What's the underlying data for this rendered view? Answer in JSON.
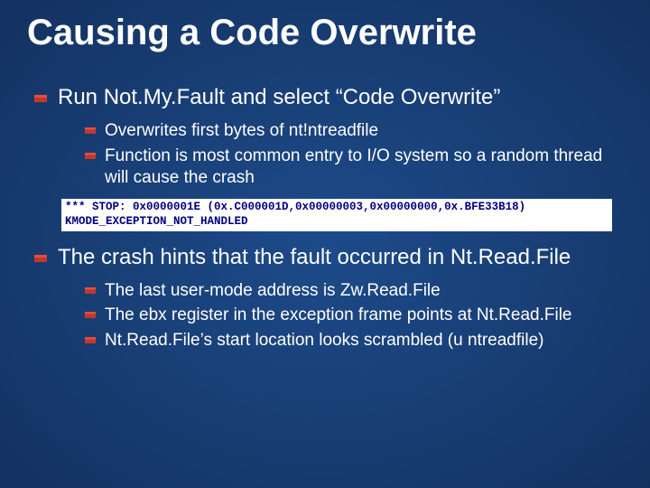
{
  "title": "Causing a Code Overwrite",
  "bullets": [
    {
      "text": "Run Not.My.Fault and select “Code Overwrite”",
      "children": [
        {
          "text": "Overwrites first bytes of nt!ntreadfile"
        },
        {
          "text": "Function is most common entry to I/O system so a random thread will cause the crash"
        }
      ]
    }
  ],
  "code": {
    "line1": "*** STOP: 0x0000001E (0x.C000001D,0x00000003,0x00000000,0x.BFE33B18)",
    "line2": "KMODE_EXCEPTION_NOT_HANDLED"
  },
  "bullets2": [
    {
      "text": "The crash hints that the fault occurred in Nt.Read.File",
      "children": [
        {
          "text": "The last user-mode address is Zw.Read.File"
        },
        {
          "text": "The ebx register in the exception frame points at Nt.Read.File"
        },
        {
          "text": "Nt.Read.File’s start location looks scrambled (u ntreadfile)"
        }
      ]
    }
  ]
}
